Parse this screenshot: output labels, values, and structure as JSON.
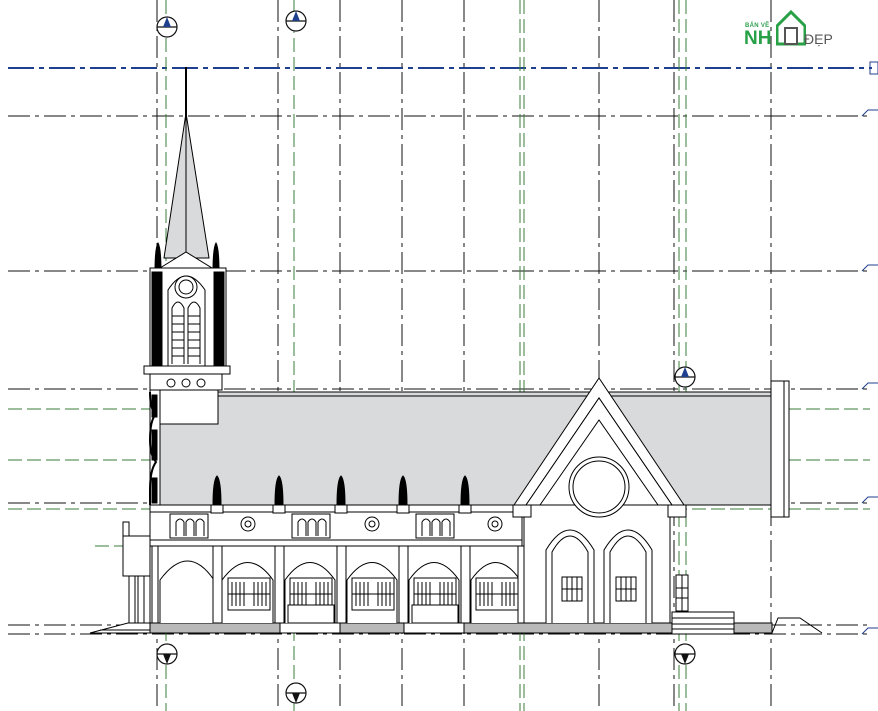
{
  "drawing": {
    "type": "church-side-elevation",
    "grid_color": "#1a1a1a",
    "ref_line_color": "#3a7d3a",
    "level_line_color": "#1f3f8f",
    "roof_fill": "#d9dadb",
    "base_fill": "#b9b9b9",
    "line_color": "#000000"
  },
  "logo": {
    "small_text": "BẢN VẼ",
    "main_text": "NH",
    "suffix_text": "ĐẸP",
    "icon": "house-icon",
    "brand_color": "#27a046"
  }
}
